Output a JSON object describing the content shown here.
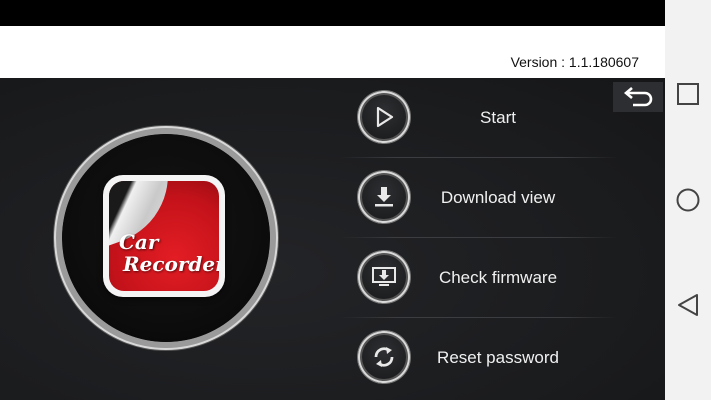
{
  "header": {
    "version": "Version : 1.1.180607"
  },
  "logo": {
    "line1": "Car",
    "line2": "Recorder"
  },
  "menu": {
    "items": [
      {
        "label": "Start",
        "icon": "play-icon"
      },
      {
        "label": "Download view",
        "icon": "download-icon"
      },
      {
        "label": "Check firmware",
        "icon": "firmware-update-icon"
      },
      {
        "label": "Reset password",
        "icon": "refresh-icon"
      }
    ]
  },
  "colors": {
    "background": "#1b1c1e",
    "header": "#ffffff",
    "logo_red": "#e31d24",
    "text": "#f0f0f0"
  }
}
